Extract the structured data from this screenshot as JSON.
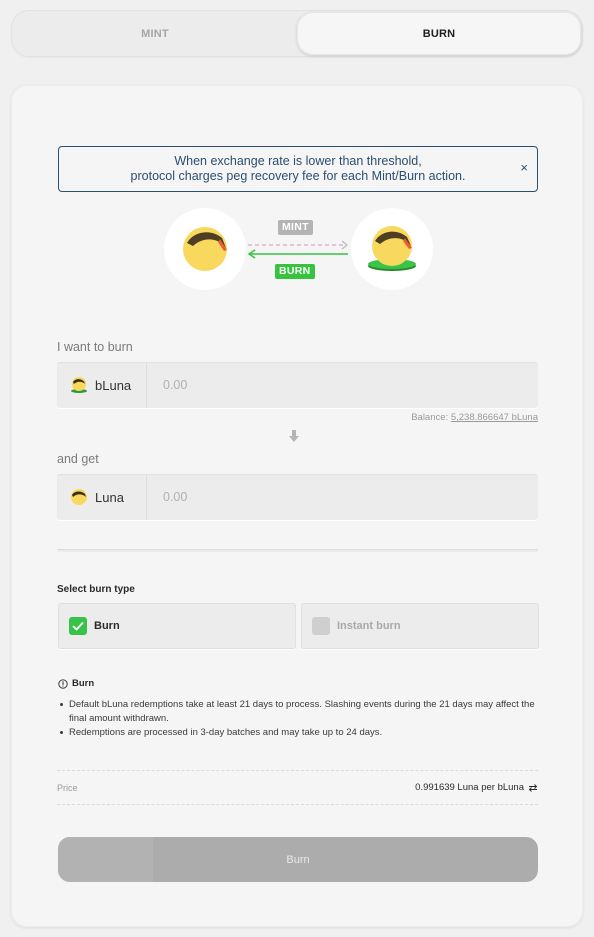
{
  "tabs": [
    {
      "label": "MINT",
      "active": false
    },
    {
      "label": "BURN",
      "active": true
    }
  ],
  "notice": {
    "text": "When exchange rate is lower than threshold,\nprotocol charges peg recovery fee for each Mint/Burn action.",
    "close_label": "×"
  },
  "illustration": {
    "mint_badge": "MINT",
    "burn_badge": "BURN"
  },
  "form": {
    "burn_label": "I want to burn",
    "burn_token": "bLuna",
    "burn_placeholder": "0.00",
    "balance_label": "Balance: ",
    "balance_value": "5,238.866647 bLuna",
    "get_label": "and get",
    "get_token": "Luna",
    "get_placeholder": "0.00"
  },
  "burn_type": {
    "title": "Select burn type",
    "options": [
      {
        "label": "Burn",
        "checked": true
      },
      {
        "label": "Instant burn",
        "checked": false
      }
    ]
  },
  "info": {
    "title": "Burn",
    "items": [
      "Default bLuna redemptions take at least 21 days to process. Slashing events during the 21 days may affect the final amount withdrawn.",
      "Redemptions are processed in 3-day batches and may take up to 24 days."
    ]
  },
  "price": {
    "label": "Price",
    "value": "0.991639 Luna per bLuna"
  },
  "submit": {
    "label": "Burn"
  },
  "colors": {
    "accent_green": "#36c43f",
    "notice_blue": "#2c4e70",
    "luna_yellow": "#f9d85e",
    "luna_orange": "#ea5b3a"
  },
  "icons": {
    "luna_token": "luna-coin-icon",
    "bluna_token": "bluna-coin-icon",
    "close": "close-icon",
    "arrow_down": "arrow-down-icon",
    "info": "info-icon",
    "swap": "swap-icon",
    "check": "check-icon"
  }
}
